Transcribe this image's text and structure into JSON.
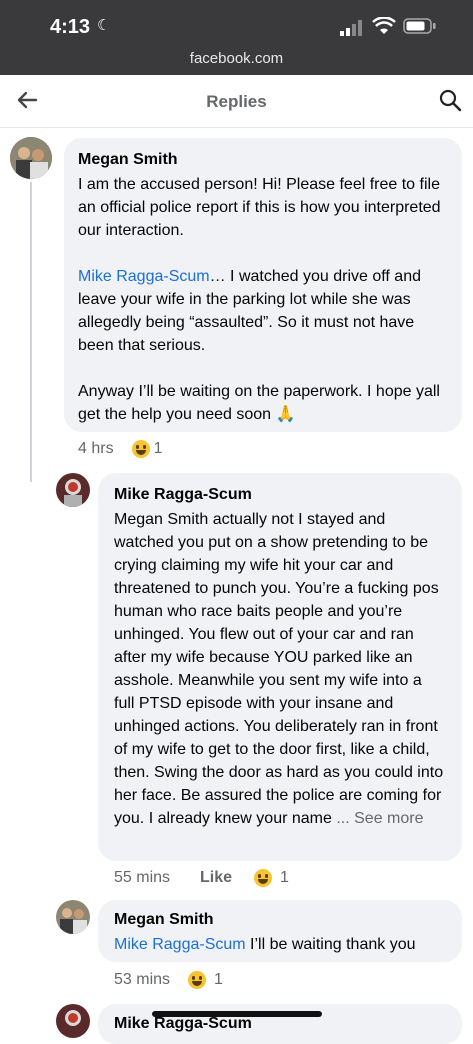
{
  "status_bar": {
    "time": "4:13",
    "url": "facebook.com"
  },
  "header": {
    "title": "Replies"
  },
  "comments": [
    {
      "author": "Megan Smith",
      "p1": "I am the accused person! Hi! Please feel free to file an official police report if this is how you interpreted our interaction.",
      "p2_link": "Mike Ragga-Scum",
      "p2_rest": "… I watched you drive off and leave your wife in the parking lot while she was allegedly being “assaulted”. So it must not have been that serious.",
      "p3": "Anyway I’ll be waiting on the paperwork. I hope yall get the help you need soon 🙏",
      "time": "4 hrs",
      "reaction_count": "1"
    },
    {
      "author": "Mike Ragga-Scum",
      "text": "Megan Smith actually not I stayed and watched you put on a show pretending to be crying claiming my wife hit your car and threatened to punch you. You’re a fucking pos human who race baits people and you’re unhinged. You flew out of your car and ran after my wife because YOU parked like an asshole. Meanwhile you sent my wife into a full PTSD episode with your insane and unhinged actions. You deliberately ran in front of my wife to get to the door first, like a child, then. Swing the door as hard as you could into her face. Be assured the police are coming for you. I already knew your name",
      "see_more": "... See more",
      "time": "55 mins",
      "like_label": "Like",
      "reaction_count": "1"
    },
    {
      "author": "Megan Smith",
      "link": "Mike Ragga-Scum",
      "rest": " I’ll be waiting thank you",
      "time": "53 mins",
      "reaction_count": "1"
    },
    {
      "author": "Mike Ragga-Scum"
    }
  ],
  "colors": {
    "link": "#1b6fd8",
    "bubble": "#f0f2f5",
    "status_bg": "#3a3a3c"
  }
}
